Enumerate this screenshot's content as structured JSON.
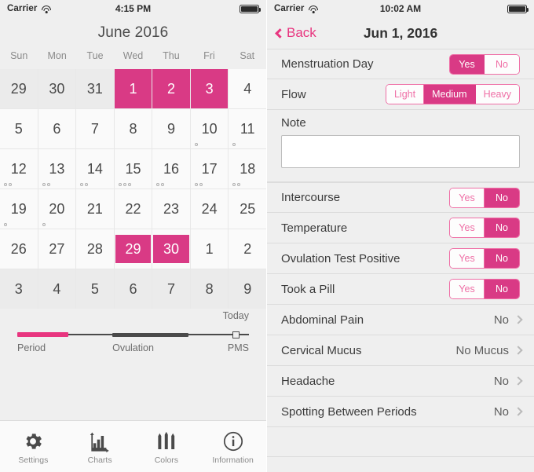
{
  "left": {
    "status_bar": {
      "carrier": "Carrier",
      "wifi_icon": "wifi-icon",
      "time": "4:15 PM",
      "battery_icon": "battery-full-icon"
    },
    "title": "June 2016",
    "weekdays": [
      "Sun",
      "Mon",
      "Tue",
      "Wed",
      "Thu",
      "Fri",
      "Sat"
    ],
    "weeks": [
      [
        {
          "n": "29",
          "out": true
        },
        {
          "n": "30",
          "out": true
        },
        {
          "n": "31",
          "out": true
        },
        {
          "n": "1",
          "period": "full"
        },
        {
          "n": "2",
          "period": "full"
        },
        {
          "n": "3",
          "period": "full"
        },
        {
          "n": "4"
        }
      ],
      [
        {
          "n": "5"
        },
        {
          "n": "6"
        },
        {
          "n": "7"
        },
        {
          "n": "8"
        },
        {
          "n": "9"
        },
        {
          "n": "10",
          "dots": 1
        },
        {
          "n": "11",
          "dots": 1
        }
      ],
      [
        {
          "n": "12",
          "dots": 2
        },
        {
          "n": "13",
          "dots": 2
        },
        {
          "n": "14",
          "dots": 2
        },
        {
          "n": "15",
          "dots": 3
        },
        {
          "n": "16",
          "dots": 2
        },
        {
          "n": "17",
          "dots": 2
        },
        {
          "n": "18",
          "dots": 2
        }
      ],
      [
        {
          "n": "19",
          "dots": 1
        },
        {
          "n": "20",
          "dots": 1
        },
        {
          "n": "21"
        },
        {
          "n": "22"
        },
        {
          "n": "23"
        },
        {
          "n": "24"
        },
        {
          "n": "25"
        }
      ],
      [
        {
          "n": "26"
        },
        {
          "n": "27"
        },
        {
          "n": "28"
        },
        {
          "n": "29",
          "period": "chip"
        },
        {
          "n": "30",
          "period": "chip"
        },
        {
          "n": "1"
        },
        {
          "n": "2"
        }
      ],
      [
        {
          "n": "3",
          "out": true
        },
        {
          "n": "4",
          "out": true
        },
        {
          "n": "5",
          "out": true
        },
        {
          "n": "6",
          "out": true
        },
        {
          "n": "7",
          "out": true
        },
        {
          "n": "8",
          "out": true
        },
        {
          "n": "9",
          "out": true
        }
      ]
    ],
    "timeline": {
      "today_label": "Today",
      "period_label": "Period",
      "ovulation_label": "Ovulation",
      "pms_label": "PMS",
      "period_color": "#e8357f",
      "ovulation_color": "#4a4a4a"
    },
    "tabs": [
      {
        "label": "Settings",
        "icon": "gear-icon"
      },
      {
        "label": "Charts",
        "icon": "bar-chart-icon"
      },
      {
        "label": "Colors",
        "icon": "pencils-icon"
      },
      {
        "label": "Information",
        "icon": "info-circle-icon"
      }
    ]
  },
  "right": {
    "status_bar": {
      "carrier": "Carrier",
      "wifi_icon": "wifi-icon",
      "time": "10:02 AM",
      "battery_icon": "battery-full-icon"
    },
    "back_label": "Back",
    "nav_title": "Jun 1, 2016",
    "rows": [
      {
        "label": "Menstruation Day",
        "type": "segment",
        "options": [
          "Yes",
          "No"
        ],
        "selected": "Yes"
      },
      {
        "label": "Flow",
        "type": "segment",
        "options": [
          "Light",
          "Medium",
          "Heavy"
        ],
        "selected": "Medium"
      }
    ],
    "note": {
      "label": "Note",
      "value": "",
      "placeholder": ""
    },
    "rows2": [
      {
        "label": "Intercourse",
        "type": "segment",
        "options": [
          "Yes",
          "No"
        ],
        "selected": "No"
      },
      {
        "label": "Temperature",
        "type": "segment",
        "options": [
          "Yes",
          "No"
        ],
        "selected": "No"
      },
      {
        "label": "Ovulation Test Positive",
        "type": "segment",
        "options": [
          "Yes",
          "No"
        ],
        "selected": "No"
      },
      {
        "label": "Took a Pill",
        "type": "segment",
        "options": [
          "Yes",
          "No"
        ],
        "selected": "No"
      },
      {
        "label": "Abdominal Pain",
        "type": "disclosure",
        "value": "No"
      },
      {
        "label": "Cervical Mucus",
        "type": "disclosure",
        "value": "No Mucus"
      },
      {
        "label": "Headache",
        "type": "disclosure",
        "value": "No"
      },
      {
        "label": "Spotting Between Periods",
        "type": "disclosure",
        "value": "No"
      }
    ],
    "accent_color": "#d93a85"
  }
}
